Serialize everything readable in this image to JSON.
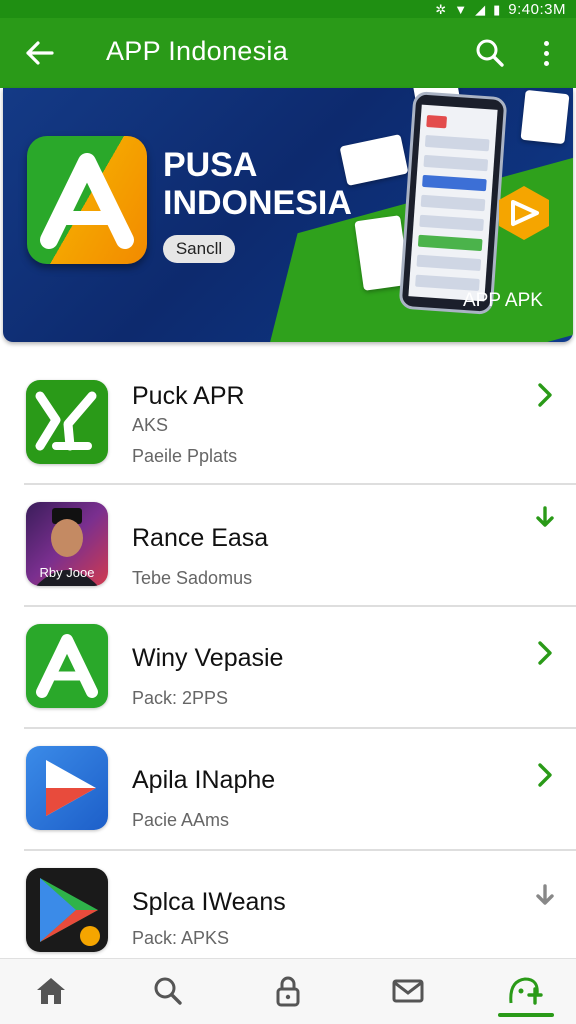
{
  "status_bar": {
    "time": "9:40:3M"
  },
  "app_bar": {
    "title": "APP Indonesia",
    "back_icon": "arrow-left-icon",
    "search_icon": "search-icon",
    "more_icon": "more-vertical-icon"
  },
  "banner": {
    "title_line1": "PUSA",
    "title_line2": "INDONESIA",
    "button_label": "Sancll",
    "tag": "APP APK"
  },
  "apps": [
    {
      "name": "Puck APR",
      "line1": "AKS",
      "line2": "Paeile Pplats",
      "action_icon": "chevron-right-icon"
    },
    {
      "name": "Rance Easa",
      "line1": "Tebe Sadomus",
      "icon_caption": "Rby Jooe",
      "action_icon": "download-icon"
    },
    {
      "name": "Winy Vepasie",
      "line1": "Pack: 2PPS",
      "action_icon": "chevron-right-icon"
    },
    {
      "name": "Apila INaphe",
      "line1": "Pacie AAms",
      "action_icon": "chevron-right-icon"
    },
    {
      "name": "Splca IWeans",
      "line1": "Pack: APKS",
      "action_icon": "download-icon"
    }
  ],
  "bottom_nav": [
    {
      "icon": "home-icon"
    },
    {
      "icon": "search-icon"
    },
    {
      "icon": "lock-icon"
    },
    {
      "icon": "mail-icon"
    },
    {
      "icon": "apps-icon",
      "active": true
    }
  ],
  "colors": {
    "primary": "#2a9a18",
    "status": "#1f8f12",
    "accent_orange": "#f5a500",
    "banner_blue": "#0d2a6e"
  }
}
